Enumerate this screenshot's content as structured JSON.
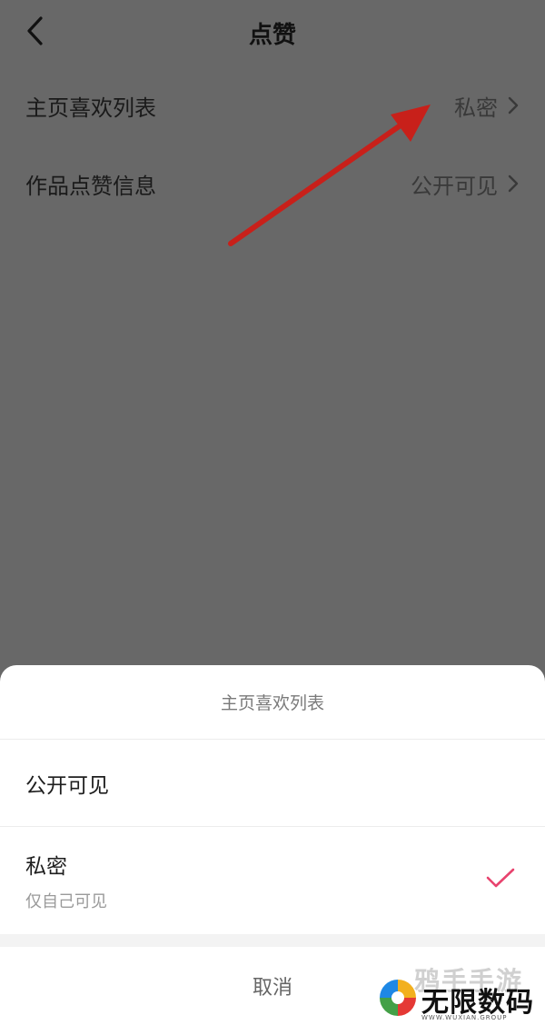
{
  "header": {
    "title": "点赞"
  },
  "settings": [
    {
      "label": "主页喜欢列表",
      "value": "私密"
    },
    {
      "label": "作品点赞信息",
      "value": "公开可见"
    }
  ],
  "sheet": {
    "title": "主页喜欢列表",
    "options": [
      {
        "label": "公开可见",
        "sublabel": "",
        "selected": false
      },
      {
        "label": "私密",
        "sublabel": "仅自己可见",
        "selected": true
      }
    ],
    "cancel_label": "取消"
  },
  "colors": {
    "accent_check": "#e8436e",
    "annotation_arrow": "#c8201a"
  },
  "watermark": {
    "faint_text": "鸦手手游",
    "main_text": "无限数码",
    "url": "WWW.WUXIAN.GROUP"
  }
}
